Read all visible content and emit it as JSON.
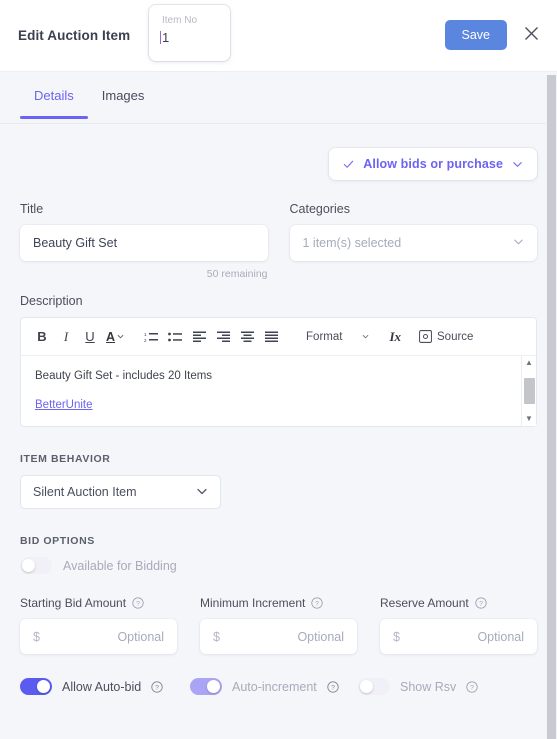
{
  "header": {
    "title": "Edit Auction Item",
    "item_no_label": "Item No",
    "item_no_value": "1",
    "save_label": "Save",
    "close_icon": "close-icon"
  },
  "tabs": [
    {
      "label": "Details",
      "active": true
    },
    {
      "label": "Images",
      "active": false
    }
  ],
  "allow_chip": {
    "label": "Allow bids or purchase",
    "left_icon": "check-icon",
    "right_icon": "chevron-down-icon"
  },
  "title_field": {
    "label": "Title",
    "value": "Beauty Gift Set",
    "remaining": "50 remaining"
  },
  "categories_field": {
    "label": "Categories",
    "value": "1 item(s) selected",
    "icon": "chevron-down-icon"
  },
  "description": {
    "label": "Description",
    "toolbar": {
      "bold": "B",
      "italic": "I",
      "underline": "U",
      "text_color": "A",
      "numbered_list": "numbered-list-icon",
      "bullet_list": "bullet-list-icon",
      "align_left": "align-left-icon",
      "align_right": "align-right-icon",
      "align_center": "align-center-icon",
      "justify": "align-justify-icon",
      "format_label": "Format",
      "remove_format": "Ix",
      "remove_format_sub": "x",
      "source_label": "Source",
      "source_icon": "source-icon"
    },
    "content_line": "Beauty Gift Set - includes 20 Items",
    "content_link": "BetterUnite"
  },
  "item_behavior": {
    "section_label": "ITEM BEHAVIOR",
    "selected": "Silent Auction Item",
    "icon": "chevron-down-icon"
  },
  "bid_options": {
    "section_label": "BID OPTIONS",
    "available_for_bidding": {
      "label": "Available for Bidding",
      "state": "off"
    }
  },
  "amount_fields": [
    {
      "label": "Starting Bid Amount",
      "currency": "$",
      "placeholder": "Optional",
      "help_icon": "help-circle-icon"
    },
    {
      "label": "Minimum Increment",
      "currency": "$",
      "placeholder": "Optional",
      "help_icon": "help-circle-icon"
    },
    {
      "label": "Reserve Amount",
      "currency": "$",
      "placeholder": "Optional",
      "help_icon": "help-circle-icon"
    }
  ],
  "bottom_toggles": [
    {
      "label": "Allow Auto-bid",
      "state": "on",
      "help_icon": "help-circle-icon"
    },
    {
      "label": "Auto-increment",
      "state": "on-dim",
      "help_icon": "help-circle-icon"
    },
    {
      "label": "Show Rsv",
      "state": "off-dim",
      "help_icon": "help-circle-icon"
    }
  ],
  "colors": {
    "accent_purple": "#6c63f2",
    "toggle_on": "#5b5bf0",
    "save_blue": "#5b86e0",
    "page_bg": "#f5f6fa",
    "text_dark": "#3b4050",
    "text_muted": "#a7abba"
  }
}
